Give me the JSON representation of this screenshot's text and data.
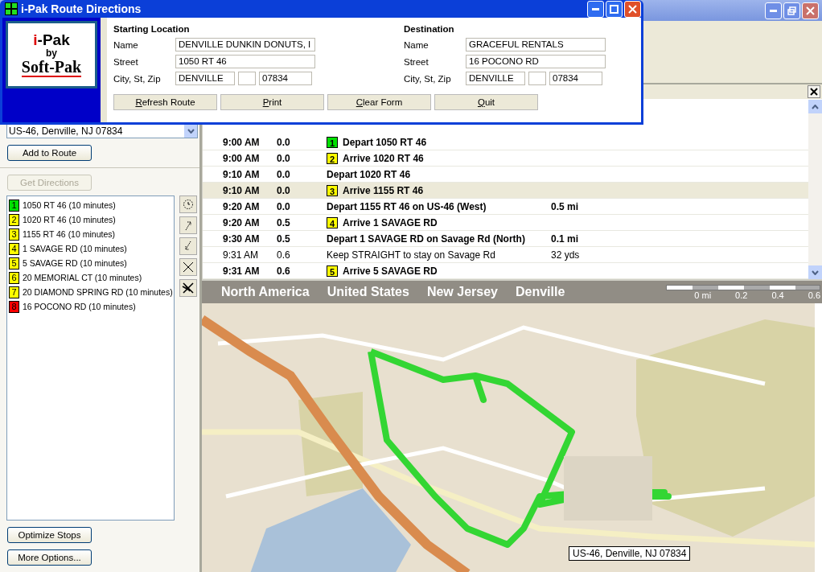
{
  "dialog": {
    "title": "i-Pak Route Directions",
    "logo": {
      "brand": "i-Pak",
      "by": "by",
      "maker": "Soft-Pak"
    },
    "locations": [
      {
        "heading": "Starting Location",
        "name_label": "Name",
        "name": "DENVILLE DUNKIN DONUTS, I",
        "street_label": "Street",
        "street": "1050 RT 46",
        "city_label": "City, St, Zip",
        "city": "DENVILLE",
        "zip": "07834"
      },
      {
        "heading": "Destination",
        "name_label": "Name",
        "name": "GRACEFUL RENTALS",
        "street_label": "Street",
        "street": "16 POCONO RD",
        "city_label": "City, St, Zip",
        "city": "DENVILLE",
        "zip": "07834"
      }
    ],
    "buttons": [
      "Refresh Route",
      "Print",
      "Clear Form",
      "Quit"
    ]
  },
  "left_panel": {
    "location_combo": "US-46, Denville, NJ 07834",
    "add_button": "Add to Route",
    "directions_button": {
      "label": "Get Directions",
      "disabled": true
    },
    "stops": [
      {
        "number": "1",
        "label": "1050 RT 46 (10 minutes)",
        "color": "#00e000"
      },
      {
        "number": "2",
        "label": "1020 RT 46 (10 minutes)",
        "color": "#ffff00"
      },
      {
        "number": "3",
        "label": "1155 RT 46 (10 minutes)",
        "color": "#ffff00"
      },
      {
        "number": "4",
        "label": "1 SAVAGE RD (10 minutes)",
        "color": "#ffff00"
      },
      {
        "number": "5",
        "label": "5 SAVAGE RD (10 minutes)",
        "color": "#ffff00"
      },
      {
        "number": "6",
        "label": "20 MEMORIAL CT (10 minutes)",
        "color": "#ffff00"
      },
      {
        "number": "7",
        "label": "20 DIAMOND SPRING RD (10 minutes)",
        "color": "#ffff00"
      },
      {
        "number": "8",
        "label": "16 POCONO RD (10 minutes)",
        "color": "#ff0000"
      }
    ],
    "bottom_buttons": [
      "Optimize Stops",
      "More Options..."
    ]
  },
  "directions": [
    {
      "time": "9:00 AM",
      "miles": "0.0",
      "stop": "1",
      "color": "#00e000",
      "text": "Depart 1050 RT 46",
      "bold": true,
      "selected": false
    },
    {
      "time": "9:00 AM",
      "miles": "0.0",
      "stop": "2",
      "color": "#ffff00",
      "text": "Arrive 1020 RT 46",
      "bold": true,
      "selected": false
    },
    {
      "time": "9:10 AM",
      "miles": "0.0",
      "text": "Depart 1020 RT 46",
      "bold": true,
      "selected": false
    },
    {
      "time": "9:10 AM",
      "miles": "0.0",
      "stop": "3",
      "color": "#ffff00",
      "text": "Arrive 1155 RT 46",
      "bold": true,
      "selected": true
    },
    {
      "time": "9:20 AM",
      "miles": "0.0",
      "text": "Depart 1155 RT 46 on US-46 (West)",
      "distance": "0.5 mi",
      "bold": true,
      "selected": false
    },
    {
      "time": "9:20 AM",
      "miles": "0.5",
      "stop": "4",
      "color": "#ffff00",
      "text": "Arrive 1 SAVAGE RD",
      "bold": true,
      "selected": false
    },
    {
      "time": "9:30 AM",
      "miles": "0.5",
      "text": "Depart 1 SAVAGE RD on Savage Rd (North)",
      "distance": "0.1 mi",
      "bold": true,
      "selected": false
    },
    {
      "time": "9:31 AM",
      "miles": "0.6",
      "text": "Keep STRAIGHT to stay on Savage Rd",
      "distance": "32 yds",
      "bold": false,
      "selected": false
    },
    {
      "time": "9:31 AM",
      "miles": "0.6",
      "stop": "5",
      "color": "#ffff00",
      "text": "Arrive 5 SAVAGE RD",
      "bold": true,
      "selected": false
    }
  ],
  "map": {
    "breadcrumbs": [
      "North America",
      "United States",
      "New Jersey",
      "Denville"
    ],
    "scale_labels": [
      "0 mi",
      "0.2",
      "0.4",
      "0.6"
    ],
    "tooltip": "US-46, Denville, NJ 07834"
  }
}
